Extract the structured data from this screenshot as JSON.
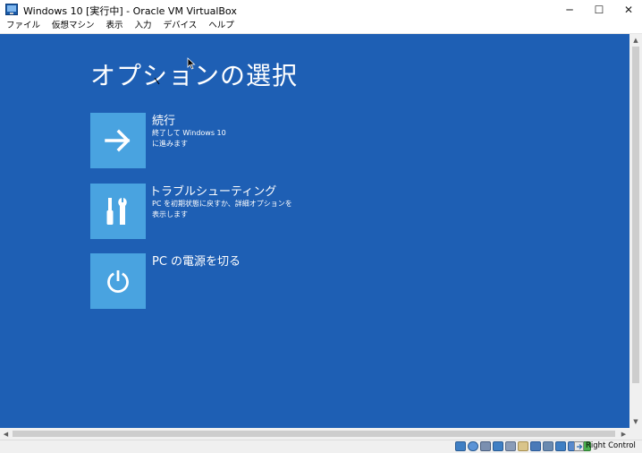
{
  "window": {
    "title": "Windows 10 [実行中] - Oracle VM VirtualBox",
    "controls": {
      "minimize": "─",
      "maximize": "☐",
      "close": "✕"
    }
  },
  "menubar": {
    "items": [
      "ファイル",
      "仮想マシン",
      "表示",
      "入力",
      "デバイス",
      "ヘルプ"
    ]
  },
  "vm_screen": {
    "background_color": "#1e5fb4",
    "tile_color": "#49a3e0",
    "title": "オプションの選択",
    "options": [
      {
        "title": "続行",
        "description": "終了して Windows 10\nに進みます",
        "icon": "arrow-right-icon"
      },
      {
        "title": "トラブルシューティング",
        "description": "PC を初期状態に戻すか、詳細オプションを\n表示します",
        "icon": "tools-icon"
      },
      {
        "title": "PC の電源を切る",
        "description": "",
        "icon": "power-icon"
      }
    ]
  },
  "statusbar": {
    "icons": [
      "hard-disk-icon",
      "optical-drive-icon",
      "audio-icon",
      "network-icon",
      "usb-icon",
      "shared-folders-icon",
      "display-icon",
      "video-capture-icon",
      "mouse-integration-icon",
      "cpu-icon",
      "virtualization-icon",
      "guest-additions-icon"
    ],
    "host_key": "Right Control"
  }
}
